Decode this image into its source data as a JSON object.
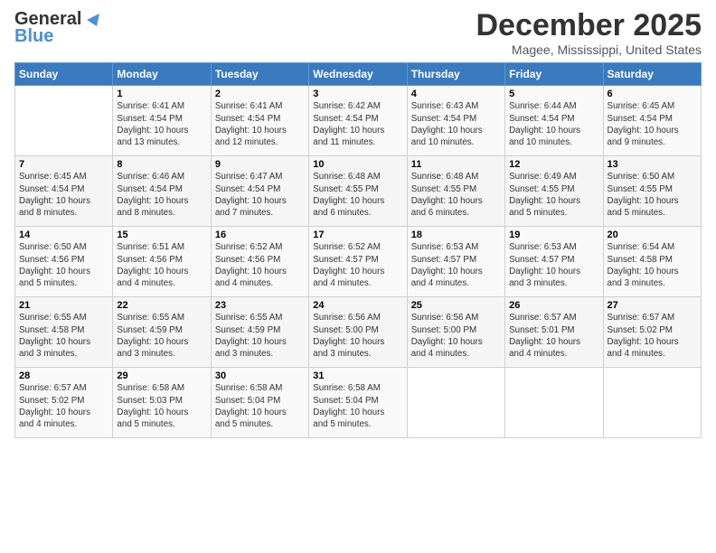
{
  "logo": {
    "line1": "General",
    "line2": "Blue"
  },
  "title": "December 2025",
  "location": "Magee, Mississippi, United States",
  "days_of_week": [
    "Sunday",
    "Monday",
    "Tuesday",
    "Wednesday",
    "Thursday",
    "Friday",
    "Saturday"
  ],
  "weeks": [
    [
      {
        "day": "",
        "info": ""
      },
      {
        "day": "1",
        "info": "Sunrise: 6:41 AM\nSunset: 4:54 PM\nDaylight: 10 hours\nand 13 minutes."
      },
      {
        "day": "2",
        "info": "Sunrise: 6:41 AM\nSunset: 4:54 PM\nDaylight: 10 hours\nand 12 minutes."
      },
      {
        "day": "3",
        "info": "Sunrise: 6:42 AM\nSunset: 4:54 PM\nDaylight: 10 hours\nand 11 minutes."
      },
      {
        "day": "4",
        "info": "Sunrise: 6:43 AM\nSunset: 4:54 PM\nDaylight: 10 hours\nand 10 minutes."
      },
      {
        "day": "5",
        "info": "Sunrise: 6:44 AM\nSunset: 4:54 PM\nDaylight: 10 hours\nand 10 minutes."
      },
      {
        "day": "6",
        "info": "Sunrise: 6:45 AM\nSunset: 4:54 PM\nDaylight: 10 hours\nand 9 minutes."
      }
    ],
    [
      {
        "day": "7",
        "info": "Sunrise: 6:45 AM\nSunset: 4:54 PM\nDaylight: 10 hours\nand 8 minutes."
      },
      {
        "day": "8",
        "info": "Sunrise: 6:46 AM\nSunset: 4:54 PM\nDaylight: 10 hours\nand 8 minutes."
      },
      {
        "day": "9",
        "info": "Sunrise: 6:47 AM\nSunset: 4:54 PM\nDaylight: 10 hours\nand 7 minutes."
      },
      {
        "day": "10",
        "info": "Sunrise: 6:48 AM\nSunset: 4:55 PM\nDaylight: 10 hours\nand 6 minutes."
      },
      {
        "day": "11",
        "info": "Sunrise: 6:48 AM\nSunset: 4:55 PM\nDaylight: 10 hours\nand 6 minutes."
      },
      {
        "day": "12",
        "info": "Sunrise: 6:49 AM\nSunset: 4:55 PM\nDaylight: 10 hours\nand 5 minutes."
      },
      {
        "day": "13",
        "info": "Sunrise: 6:50 AM\nSunset: 4:55 PM\nDaylight: 10 hours\nand 5 minutes."
      }
    ],
    [
      {
        "day": "14",
        "info": "Sunrise: 6:50 AM\nSunset: 4:56 PM\nDaylight: 10 hours\nand 5 minutes."
      },
      {
        "day": "15",
        "info": "Sunrise: 6:51 AM\nSunset: 4:56 PM\nDaylight: 10 hours\nand 4 minutes."
      },
      {
        "day": "16",
        "info": "Sunrise: 6:52 AM\nSunset: 4:56 PM\nDaylight: 10 hours\nand 4 minutes."
      },
      {
        "day": "17",
        "info": "Sunrise: 6:52 AM\nSunset: 4:57 PM\nDaylight: 10 hours\nand 4 minutes."
      },
      {
        "day": "18",
        "info": "Sunrise: 6:53 AM\nSunset: 4:57 PM\nDaylight: 10 hours\nand 4 minutes."
      },
      {
        "day": "19",
        "info": "Sunrise: 6:53 AM\nSunset: 4:57 PM\nDaylight: 10 hours\nand 3 minutes."
      },
      {
        "day": "20",
        "info": "Sunrise: 6:54 AM\nSunset: 4:58 PM\nDaylight: 10 hours\nand 3 minutes."
      }
    ],
    [
      {
        "day": "21",
        "info": "Sunrise: 6:55 AM\nSunset: 4:58 PM\nDaylight: 10 hours\nand 3 minutes."
      },
      {
        "day": "22",
        "info": "Sunrise: 6:55 AM\nSunset: 4:59 PM\nDaylight: 10 hours\nand 3 minutes."
      },
      {
        "day": "23",
        "info": "Sunrise: 6:55 AM\nSunset: 4:59 PM\nDaylight: 10 hours\nand 3 minutes."
      },
      {
        "day": "24",
        "info": "Sunrise: 6:56 AM\nSunset: 5:00 PM\nDaylight: 10 hours\nand 3 minutes."
      },
      {
        "day": "25",
        "info": "Sunrise: 6:56 AM\nSunset: 5:00 PM\nDaylight: 10 hours\nand 4 minutes."
      },
      {
        "day": "26",
        "info": "Sunrise: 6:57 AM\nSunset: 5:01 PM\nDaylight: 10 hours\nand 4 minutes."
      },
      {
        "day": "27",
        "info": "Sunrise: 6:57 AM\nSunset: 5:02 PM\nDaylight: 10 hours\nand 4 minutes."
      }
    ],
    [
      {
        "day": "28",
        "info": "Sunrise: 6:57 AM\nSunset: 5:02 PM\nDaylight: 10 hours\nand 4 minutes."
      },
      {
        "day": "29",
        "info": "Sunrise: 6:58 AM\nSunset: 5:03 PM\nDaylight: 10 hours\nand 5 minutes."
      },
      {
        "day": "30",
        "info": "Sunrise: 6:58 AM\nSunset: 5:04 PM\nDaylight: 10 hours\nand 5 minutes."
      },
      {
        "day": "31",
        "info": "Sunrise: 6:58 AM\nSunset: 5:04 PM\nDaylight: 10 hours\nand 5 minutes."
      },
      {
        "day": "",
        "info": ""
      },
      {
        "day": "",
        "info": ""
      },
      {
        "day": "",
        "info": ""
      }
    ]
  ]
}
